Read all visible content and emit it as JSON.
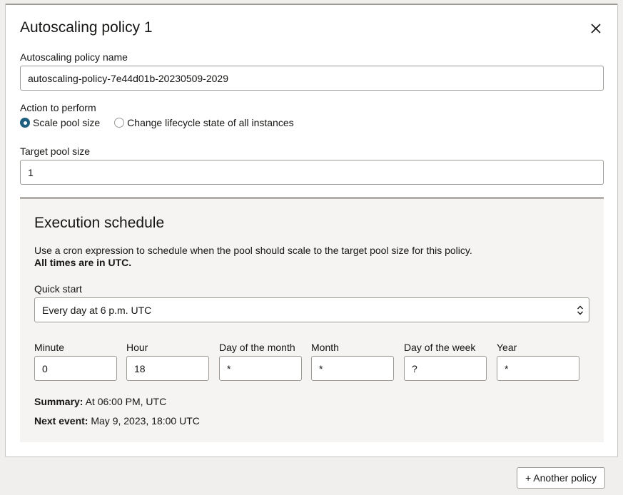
{
  "panel": {
    "title": "Autoscaling policy 1"
  },
  "policy_name": {
    "label": "Autoscaling policy name",
    "value": "autoscaling-policy-7e44d01b-20230509-2029"
  },
  "action": {
    "label": "Action to perform",
    "options": [
      {
        "label": "Scale pool size",
        "selected": true
      },
      {
        "label": "Change lifecycle state of all instances",
        "selected": false
      }
    ]
  },
  "target_pool_size": {
    "label": "Target pool size",
    "value": "1"
  },
  "schedule": {
    "title": "Execution schedule",
    "description": "Use a cron expression to schedule when the pool should scale to the target pool size for this policy.",
    "description_bold": "All times are in UTC.",
    "quick_start": {
      "label": "Quick start",
      "value": "Every day at 6 p.m. UTC"
    },
    "fields": [
      {
        "label": "Minute",
        "value": "0"
      },
      {
        "label": "Hour",
        "value": "18"
      },
      {
        "label": "Day of the month",
        "value": "*"
      },
      {
        "label": "Month",
        "value": "*"
      },
      {
        "label": "Day of the week",
        "value": "?"
      },
      {
        "label": "Year",
        "value": "*"
      }
    ],
    "summary_label": "Summary:",
    "summary_value": "At 06:00 PM, UTC",
    "next_event_label": "Next event:",
    "next_event_value": "May 9, 2023, 18:00 UTC"
  },
  "footer": {
    "another_policy_label": "+ Another policy"
  },
  "colors": {
    "accent": "#1f5f80",
    "border": "#9e9b97",
    "background": "#f1efed",
    "schedule_bg": "#f5f4f2"
  },
  "icons": {
    "close": "close-icon",
    "select": "chevron-updown-icon"
  }
}
